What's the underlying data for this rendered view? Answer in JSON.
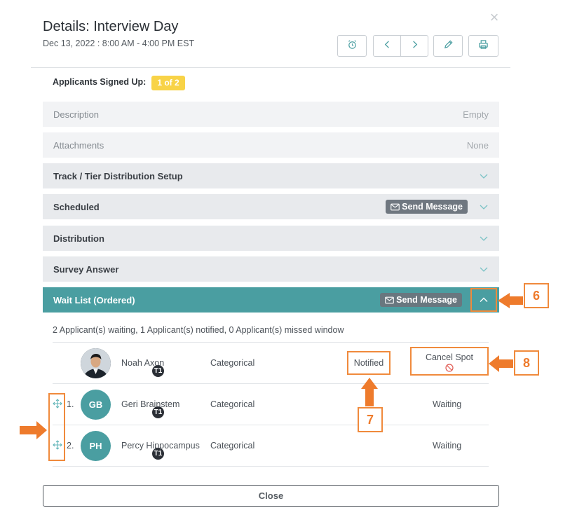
{
  "header": {
    "title": "Details: Interview Day",
    "subtitle": "Dec 13, 2022  :  8:00 AM - 4:00 PM EST"
  },
  "toolbar": {
    "icons": [
      "alarm-icon",
      "chevron-left-icon",
      "chevron-right-icon",
      "pencil-icon",
      "printer-icon"
    ]
  },
  "summary": {
    "signed_up_label": "Applicants Signed Up:",
    "signed_up_badge": "1 of 2"
  },
  "sections": {
    "description": {
      "label": "Description",
      "value": "Empty"
    },
    "attachments": {
      "label": "Attachments",
      "value": "None"
    },
    "track": {
      "label": "Track / Tier Distribution Setup"
    },
    "scheduled": {
      "label": "Scheduled",
      "send": "Send Message"
    },
    "distribution": {
      "label": "Distribution"
    },
    "survey": {
      "label": "Survey Answer"
    },
    "waitlist": {
      "label": "Wait List (Ordered)",
      "send": "Send Message"
    }
  },
  "waitlist": {
    "summary": "2 Applicant(s) waiting, 1 Applicant(s) notified, 0 Applicant(s) missed window",
    "rows": [
      {
        "index": "",
        "initials": "",
        "tier": "T1",
        "name": "Noah Axon",
        "category": "Categorical",
        "status": "Notified",
        "action": "Cancel Spot"
      },
      {
        "index": "1.",
        "initials": "GB",
        "tier": "T1",
        "name": "Geri Brainstem",
        "category": "Categorical",
        "status": "Waiting"
      },
      {
        "index": "2.",
        "initials": "PH",
        "tier": "T1",
        "name": "Percy Hippocampus",
        "category": "Categorical",
        "status": "Waiting"
      }
    ]
  },
  "callouts": {
    "c6": "6",
    "c7": "7",
    "c8": "8"
  },
  "footer": {
    "close_label": "Close"
  },
  "colors": {
    "accent": "#4a9ea1",
    "badge": "#f8d347",
    "callout": "#f08a3c"
  }
}
